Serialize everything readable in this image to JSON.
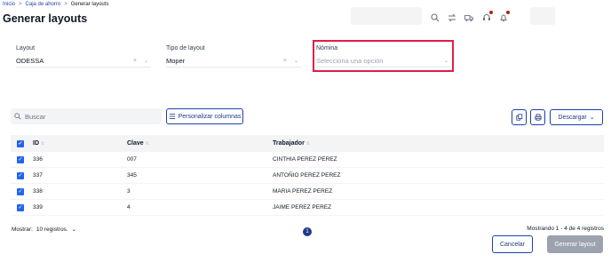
{
  "breadcrumb": {
    "inicio": "Inicio",
    "caja": "Caja de ahorro",
    "current": "Generar layouts",
    "sep": ">"
  },
  "page_title": "Generar layouts",
  "form": {
    "layout": {
      "label": "Layout",
      "value": "ODESSA"
    },
    "tipo": {
      "label": "Tipo de layout",
      "value": "Moper"
    },
    "nomina": {
      "label": "Nómina",
      "placeholder": "Selecciona una opción"
    },
    "clear_glyph": "×",
    "chevron_glyph": "⌄"
  },
  "toolbar": {
    "search_placeholder": "Buscar",
    "personalizar_label": "Personalizar columnas",
    "descargar_label": "Descargar"
  },
  "table": {
    "headers": {
      "id": "ID",
      "clave": "Clave",
      "trabajador": "Trabajador"
    },
    "rows": [
      {
        "id": "336",
        "clave": "007",
        "trabajador": "CINTHIA PEREZ PEREZ"
      },
      {
        "id": "337",
        "clave": "345",
        "trabajador": "ANTOÑIO PEREZ PEREZ"
      },
      {
        "id": "338",
        "clave": "3",
        "trabajador": "MARIA PEREZ PEREZ"
      },
      {
        "id": "339",
        "clave": "4",
        "trabajador": "JAIME PEREZ PEREZ"
      }
    ]
  },
  "footer": {
    "mostrar_label": "Mostrar:",
    "mostrar_value": "10 registros.",
    "page": "1",
    "mostrando": "Mostrando 1 - 4 de 4 registros"
  },
  "actions": {
    "cancelar": "Cancelar",
    "generar": "Generar layout"
  },
  "colors": {
    "accent": "#1e40af",
    "checkbox": "#2563eb",
    "highlight": "#e11d48",
    "notification": "#b91c1c"
  }
}
